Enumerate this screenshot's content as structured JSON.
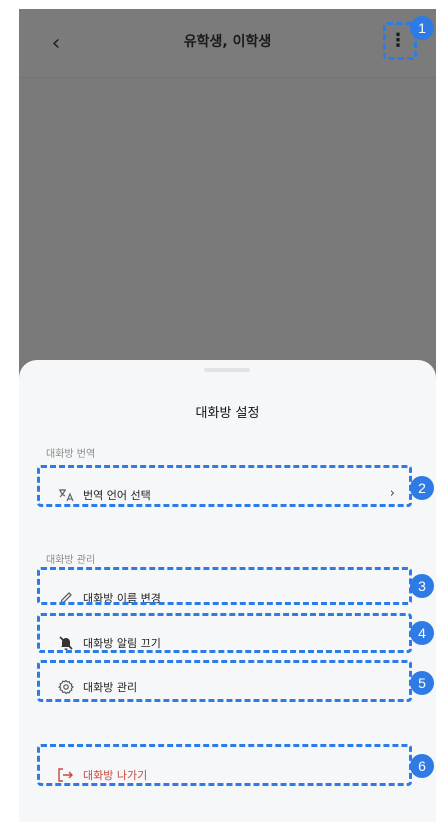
{
  "header": {
    "title": "유학생, 이학생",
    "back_icon": "chevron-left-icon",
    "more_icon": "more-vertical-icon"
  },
  "sheet": {
    "title": "대화방 설정",
    "translate_section": "대화방 번역",
    "translate_item": "번역 언어 선택",
    "manage_section": "대화방 관리",
    "rename_item": "대화방 이름 변경",
    "mute_item": "대화방 알림 끄기",
    "manage_item": "대화방 관리",
    "leave_item": "대화방 나가기"
  },
  "badges": [
    "1",
    "2",
    "3",
    "4",
    "5",
    "6"
  ],
  "colors": {
    "highlight": "#2f7be6",
    "danger": "#c9483c",
    "overlay": "#7a7a7a"
  }
}
